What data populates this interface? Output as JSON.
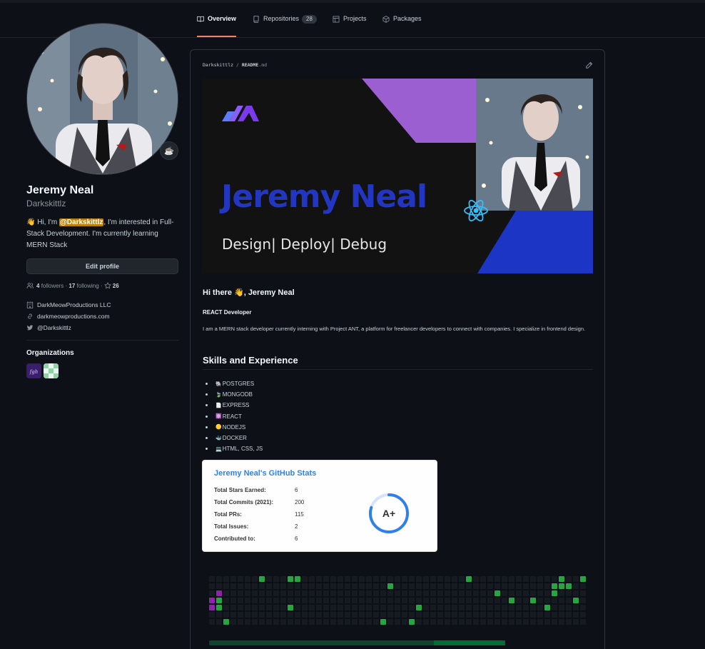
{
  "tabs": [
    {
      "label": "Overview"
    },
    {
      "label": "Repositories",
      "count": "28"
    },
    {
      "label": "Projects"
    },
    {
      "label": "Packages"
    }
  ],
  "profile": {
    "name": "Jeremy Neal",
    "login": "Darkskittlz",
    "status_emoji": "☕",
    "bio_prefix": "👋 Hi, I'm ",
    "bio_mention": "@Darkskittlz",
    "bio_suffix": ", I'm interested in Full-Stack Development. I'm currently learning MERN Stack",
    "edit_button": "Edit profile",
    "followers_count": "4",
    "followers_label": "followers",
    "following_count": "17",
    "following_label": "following",
    "stars_count": "26",
    "company": "DarkMeowProductions LLC",
    "website": "darkmeowproductions.com",
    "twitter": "@Darkskittlz",
    "orgs_heading": "Organizations"
  },
  "readme": {
    "owner": "Darkskittlz",
    "sep": "/",
    "file": "README",
    "ext": ".md",
    "banner_name": "Jeremy Neal",
    "banner_tagline": "Design| Deploy| Debug",
    "greeting": "Hi there 👋, Jeremy Neal",
    "role": "REACT Developer",
    "intro": "I am a MERN stack developer currently interning with Project ANT, a platform for freelancer developers to connect with companies. I specialize in frontend design.",
    "skills_heading": "Skills and Experience",
    "skills": [
      {
        "emoji": "🐘",
        "label": "POSTGRES"
      },
      {
        "emoji": "🍃",
        "label": "MONGODB"
      },
      {
        "emoji": "📄",
        "label": "EXPRESS"
      },
      {
        "emoji": "⚛️",
        "label": "REACT"
      },
      {
        "emoji": "🟡",
        "label": "NODEJS"
      },
      {
        "emoji": "🐳",
        "label": "DOCKER"
      },
      {
        "emoji": "💻",
        "label": "HTML, CSS, JS"
      }
    ]
  },
  "stats": {
    "title": "Jeremy Neal's GitHub Stats",
    "rows": [
      {
        "label": "Total Stars Earned:",
        "value": "6"
      },
      {
        "label": "Total Commits (2021):",
        "value": "200"
      },
      {
        "label": "Total PRs:",
        "value": "115"
      },
      {
        "label": "Total Issues:",
        "value": "2"
      },
      {
        "label": "Contributed to:",
        "value": "6"
      }
    ],
    "grade": "A+",
    "grade_progress": 0.8,
    "title_color": "#2f80ed",
    "ring_color": "#2f80ed"
  },
  "colors": {
    "background": "#0d1117",
    "selected_tab_underline": "#f78166",
    "mention_highlight": "#bb8009",
    "banner_accent_purple": "#9b5fd1",
    "banner_accent_blue": "#1d35c4"
  }
}
